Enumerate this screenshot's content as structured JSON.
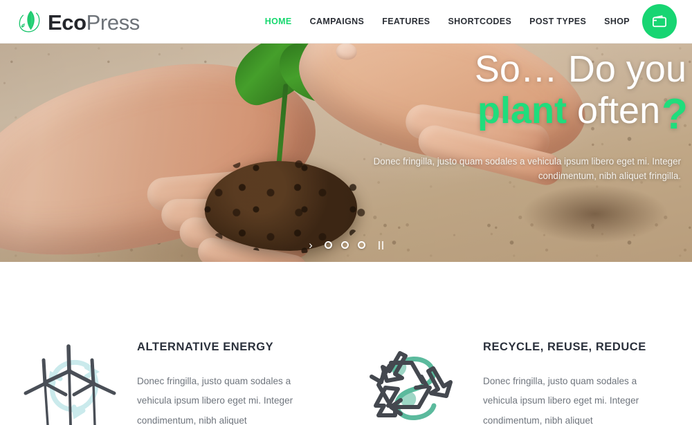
{
  "brand": {
    "name_bold": "Eco",
    "name_light": "Press",
    "logo_icon": "leaf-circle-icon"
  },
  "nav": {
    "items": [
      {
        "label": "HOME",
        "active": true
      },
      {
        "label": "CAMPAIGNS",
        "active": false
      },
      {
        "label": "FEATURES",
        "active": false
      },
      {
        "label": "SHORTCODES",
        "active": false
      },
      {
        "label": "POST TYPES",
        "active": false
      },
      {
        "label": "SHOP",
        "active": false
      }
    ],
    "cart_icon": "wallet-icon"
  },
  "hero": {
    "line1_part1": "So… ",
    "line1_part2": "Do you",
    "line2_green": "plant",
    "line2_white": " often",
    "question_mark": "?",
    "subtitle": "Donec fringilla, justo quam sodales a vehicula ipsum libero eget mi. Integer condimentum, nibh aliquet fringilla.",
    "image_alt": "hands planting a seedling in soil",
    "controls": {
      "next_arrow": "›",
      "dots": 3,
      "active_dot_index": 1,
      "pause_icon": "pause-icon"
    }
  },
  "features": [
    {
      "icon": "wind-turbines-icon",
      "title": "ALTERNATIVE ENERGY",
      "text": "Donec fringilla, justo quam sodales a vehicula ipsum libero eget mi. Integer condimentum, nibh aliquet"
    },
    {
      "icon": "recycle-leaf-icon",
      "title": "RECYCLE, REUSE, REDUCE",
      "text": "Donec fringilla, justo quam sodales a vehicula ipsum libero eget mi. Integer condimentum, nibh aliquet"
    }
  ],
  "colors": {
    "accent_green": "#17d572",
    "hero_green": "#1fdd7c",
    "heading_dark": "#2b313c",
    "body_gray": "#6f757d",
    "icon_gray": "#4a4f57",
    "icon_teal": "#9fd9de",
    "icon_green": "#3fae8c"
  }
}
